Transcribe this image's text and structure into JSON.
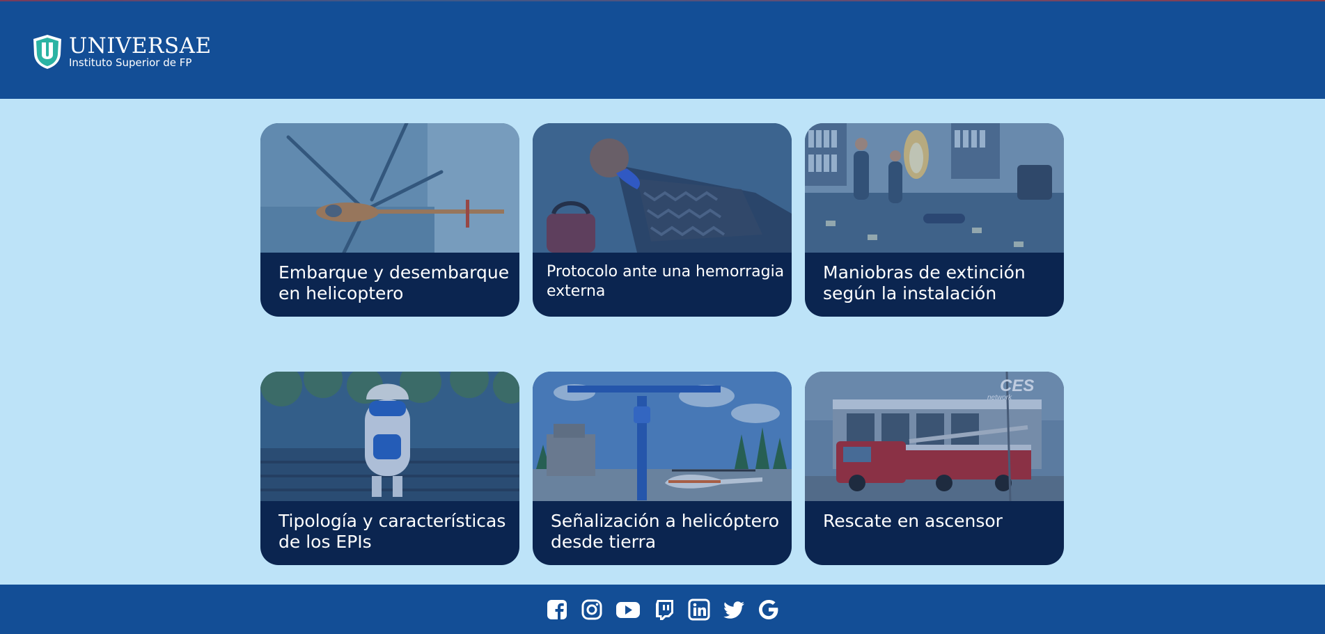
{
  "header": {
    "logo": {
      "brand": "UNIVERSAE",
      "subtitle": "Instituto Superior de FP",
      "mark": "U"
    }
  },
  "cards": [
    {
      "title": "Embarque y desembarque en helicoptero",
      "thumbnail": "helicopter-scene"
    },
    {
      "title": "Protocolo ante una hemorragia externa",
      "thumbnail": "injured-person-scene"
    },
    {
      "title": "Maniobras de extinción según la instalación",
      "thumbnail": "office-fire-scene"
    },
    {
      "title": "Tipología y características de los EPIs",
      "thumbnail": "robot-scene"
    },
    {
      "title": "Señalización a helicóptero desde tierra",
      "thumbnail": "crane-helicopter-scene"
    },
    {
      "title": "Rescate en ascensor",
      "thumbnail": "fire-truck-scene",
      "sign": "CES",
      "sign_sub": "network"
    }
  ],
  "footer": {
    "social": [
      "facebook-icon",
      "instagram-icon",
      "youtube-icon",
      "twitch-icon",
      "linkedin-icon",
      "twitter-icon",
      "google-icon"
    ]
  },
  "colors": {
    "header_bg": "#134e96",
    "page_bg": "#bde3f8",
    "card_bg": "#0b2550",
    "text": "#ffffff"
  }
}
